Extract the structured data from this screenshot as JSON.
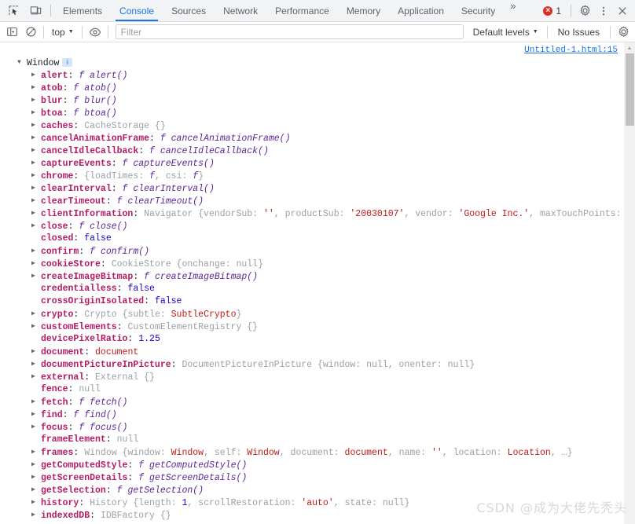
{
  "tabbar": {
    "inspect_icon": "inspect-element-icon",
    "device_icon": "device-toolbar-icon",
    "tabs": [
      {
        "label": "Elements",
        "active": false
      },
      {
        "label": "Console",
        "active": true
      },
      {
        "label": "Sources",
        "active": false
      },
      {
        "label": "Network",
        "active": false
      },
      {
        "label": "Performance",
        "active": false
      },
      {
        "label": "Memory",
        "active": false
      },
      {
        "label": "Application",
        "active": false
      },
      {
        "label": "Security",
        "active": false
      }
    ],
    "more_tabs": "»",
    "error_count": "1",
    "error_glyph": "×",
    "settings_icon": "gear-icon",
    "menu_icon": "kebab-menu-icon",
    "close_icon": "close-icon"
  },
  "console_toolbar": {
    "sidebar_icon": "console-sidebar-icon",
    "clear_icon": "clear-console-icon",
    "context": "top",
    "eye_icon": "live-expressions-eye-icon",
    "filter_placeholder": "Filter",
    "filter_value": "",
    "levels": "Default levels",
    "issues": "No Issues",
    "settings_icon": "console-settings-gear-icon"
  },
  "console": {
    "source_link": "Untitled-1.html:15",
    "root": {
      "arrow": "▼",
      "label": "Window",
      "badge": "i"
    },
    "rows": [
      {
        "arrow": "▶",
        "name": "alert",
        "parts": [
          {
            "t": "fsym",
            "v": "f "
          },
          {
            "t": "vfunc",
            "v": "alert()"
          }
        ]
      },
      {
        "arrow": "▶",
        "name": "atob",
        "parts": [
          {
            "t": "fsym",
            "v": "f "
          },
          {
            "t": "vfunc",
            "v": "atob()"
          }
        ]
      },
      {
        "arrow": "▶",
        "name": "blur",
        "parts": [
          {
            "t": "fsym",
            "v": "f "
          },
          {
            "t": "vfunc",
            "v": "blur()"
          }
        ]
      },
      {
        "arrow": "▶",
        "name": "btoa",
        "parts": [
          {
            "t": "fsym",
            "v": "f "
          },
          {
            "t": "vfunc",
            "v": "btoa()"
          }
        ]
      },
      {
        "arrow": "▶",
        "name": "caches",
        "parts": [
          {
            "t": "vclass",
            "v": "CacheStorage {}"
          }
        ]
      },
      {
        "arrow": "▶",
        "name": "cancelAnimationFrame",
        "parts": [
          {
            "t": "fsym",
            "v": "f "
          },
          {
            "t": "vfunc",
            "v": "cancelAnimationFrame()"
          }
        ]
      },
      {
        "arrow": "▶",
        "name": "cancelIdleCallback",
        "parts": [
          {
            "t": "fsym",
            "v": "f "
          },
          {
            "t": "vfunc",
            "v": "cancelIdleCallback()"
          }
        ]
      },
      {
        "arrow": "▶",
        "name": "captureEvents",
        "parts": [
          {
            "t": "fsym",
            "v": "f "
          },
          {
            "t": "vfunc",
            "v": "captureEvents()"
          }
        ]
      },
      {
        "arrow": "▶",
        "name": "chrome",
        "parts": [
          {
            "t": "vclass",
            "v": "{loadTimes: "
          },
          {
            "t": "fsym",
            "v": "f"
          },
          {
            "t": "vclass",
            "v": ", csi: "
          },
          {
            "t": "fsym",
            "v": "f"
          },
          {
            "t": "vclass",
            "v": "}"
          }
        ]
      },
      {
        "arrow": "▶",
        "name": "clearInterval",
        "parts": [
          {
            "t": "fsym",
            "v": "f "
          },
          {
            "t": "vfunc",
            "v": "clearInterval()"
          }
        ]
      },
      {
        "arrow": "▶",
        "name": "clearTimeout",
        "parts": [
          {
            "t": "fsym",
            "v": "f "
          },
          {
            "t": "vfunc",
            "v": "clearTimeout()"
          }
        ]
      },
      {
        "arrow": "▶",
        "name": "clientInformation",
        "parts": [
          {
            "t": "vclass",
            "v": "Navigator {vendorSub: "
          },
          {
            "t": "vstr",
            "v": "''"
          },
          {
            "t": "vclass",
            "v": ", productSub: "
          },
          {
            "t": "vstr",
            "v": "'20030107'"
          },
          {
            "t": "vclass",
            "v": ", vendor: "
          },
          {
            "t": "vstr",
            "v": "'Google Inc.'"
          },
          {
            "t": "vclass",
            "v": ", maxTouchPoints:"
          }
        ]
      },
      {
        "arrow": "▶",
        "name": "close",
        "parts": [
          {
            "t": "fsym",
            "v": "f "
          },
          {
            "t": "vfunc",
            "v": "close()"
          }
        ]
      },
      {
        "arrow": "",
        "name": "closed",
        "parts": [
          {
            "t": "vbool",
            "v": "false"
          }
        ]
      },
      {
        "arrow": "▶",
        "name": "confirm",
        "parts": [
          {
            "t": "fsym",
            "v": "f "
          },
          {
            "t": "vfunc",
            "v": "confirm()"
          }
        ]
      },
      {
        "arrow": "▶",
        "name": "cookieStore",
        "parts": [
          {
            "t": "vclass",
            "v": "CookieStore {onchange: "
          },
          {
            "t": "vnull",
            "v": "null"
          },
          {
            "t": "vclass",
            "v": "}"
          }
        ]
      },
      {
        "arrow": "▶",
        "name": "createImageBitmap",
        "parts": [
          {
            "t": "fsym",
            "v": "f "
          },
          {
            "t": "vfunc",
            "v": "createImageBitmap()"
          }
        ]
      },
      {
        "arrow": "",
        "name": "credentialless",
        "parts": [
          {
            "t": "vbool",
            "v": "false"
          }
        ]
      },
      {
        "arrow": "",
        "name": "crossOriginIsolated",
        "parts": [
          {
            "t": "vbool",
            "v": "false"
          }
        ]
      },
      {
        "arrow": "▶",
        "name": "crypto",
        "parts": [
          {
            "t": "vclass",
            "v": "Crypto {subtle: "
          },
          {
            "t": "vdoc",
            "v": "SubtleCrypto"
          },
          {
            "t": "vclass",
            "v": "}"
          }
        ]
      },
      {
        "arrow": "▶",
        "name": "customElements",
        "parts": [
          {
            "t": "vclass",
            "v": "CustomElementRegistry {}"
          }
        ]
      },
      {
        "arrow": "",
        "name": "devicePixelRatio",
        "parts": [
          {
            "t": "vnum",
            "v": "1.25"
          }
        ]
      },
      {
        "arrow": "▶",
        "name": "document",
        "parts": [
          {
            "t": "vdoc",
            "v": "document"
          }
        ]
      },
      {
        "arrow": "▶",
        "name": "documentPictureInPicture",
        "parts": [
          {
            "t": "vclass",
            "v": "DocumentPictureInPicture {window: "
          },
          {
            "t": "vnull",
            "v": "null"
          },
          {
            "t": "vclass",
            "v": ", onenter: "
          },
          {
            "t": "vnull",
            "v": "null"
          },
          {
            "t": "vclass",
            "v": "}"
          }
        ]
      },
      {
        "arrow": "▶",
        "name": "external",
        "parts": [
          {
            "t": "vclass",
            "v": "External {}"
          }
        ]
      },
      {
        "arrow": "",
        "name": "fence",
        "parts": [
          {
            "t": "vnull",
            "v": "null"
          }
        ]
      },
      {
        "arrow": "▶",
        "name": "fetch",
        "parts": [
          {
            "t": "fsym",
            "v": "f "
          },
          {
            "t": "vfunc",
            "v": "fetch()"
          }
        ]
      },
      {
        "arrow": "▶",
        "name": "find",
        "parts": [
          {
            "t": "fsym",
            "v": "f "
          },
          {
            "t": "vfunc",
            "v": "find()"
          }
        ]
      },
      {
        "arrow": "▶",
        "name": "focus",
        "parts": [
          {
            "t": "fsym",
            "v": "f "
          },
          {
            "t": "vfunc",
            "v": "focus()"
          }
        ]
      },
      {
        "arrow": "",
        "name": "frameElement",
        "parts": [
          {
            "t": "vnull",
            "v": "null"
          }
        ]
      },
      {
        "arrow": "▶",
        "name": "frames",
        "parts": [
          {
            "t": "vclass",
            "v": "Window {window: "
          },
          {
            "t": "vdoc",
            "v": "Window"
          },
          {
            "t": "vclass",
            "v": ", self: "
          },
          {
            "t": "vdoc",
            "v": "Window"
          },
          {
            "t": "vclass",
            "v": ", document: "
          },
          {
            "t": "vdoc",
            "v": "document"
          },
          {
            "t": "vclass",
            "v": ", name: "
          },
          {
            "t": "vstr",
            "v": "''"
          },
          {
            "t": "vclass",
            "v": ", location: "
          },
          {
            "t": "vdoc",
            "v": "Location"
          },
          {
            "t": "vclass",
            "v": ", …}"
          }
        ]
      },
      {
        "arrow": "▶",
        "name": "getComputedStyle",
        "parts": [
          {
            "t": "fsym",
            "v": "f "
          },
          {
            "t": "vfunc",
            "v": "getComputedStyle()"
          }
        ]
      },
      {
        "arrow": "▶",
        "name": "getScreenDetails",
        "parts": [
          {
            "t": "fsym",
            "v": "f "
          },
          {
            "t": "vfunc",
            "v": "getScreenDetails()"
          }
        ]
      },
      {
        "arrow": "▶",
        "name": "getSelection",
        "parts": [
          {
            "t": "fsym",
            "v": "f "
          },
          {
            "t": "vfunc",
            "v": "getSelection()"
          }
        ]
      },
      {
        "arrow": "▶",
        "name": "history",
        "parts": [
          {
            "t": "vclass",
            "v": "History {length: "
          },
          {
            "t": "vnum",
            "v": "1"
          },
          {
            "t": "vclass",
            "v": ", scrollRestoration: "
          },
          {
            "t": "vstr",
            "v": "'auto'"
          },
          {
            "t": "vclass",
            "v": ", state: "
          },
          {
            "t": "vnull",
            "v": "null"
          },
          {
            "t": "vclass",
            "v": "}"
          }
        ]
      },
      {
        "arrow": "▶",
        "name": "indexedDB",
        "parts": [
          {
            "t": "vclass",
            "v": "IDBFactory {}"
          }
        ]
      }
    ]
  },
  "scrollbar": {
    "up_arrow": "▲"
  },
  "watermark": "CSDN @成为大佬先秃头",
  "colors": {
    "accent": "#1a73e8",
    "error": "#d93025",
    "property": "#b51b63",
    "string": "#c41a16",
    "number": "#1c00cf",
    "class": "#9aa0a6"
  }
}
